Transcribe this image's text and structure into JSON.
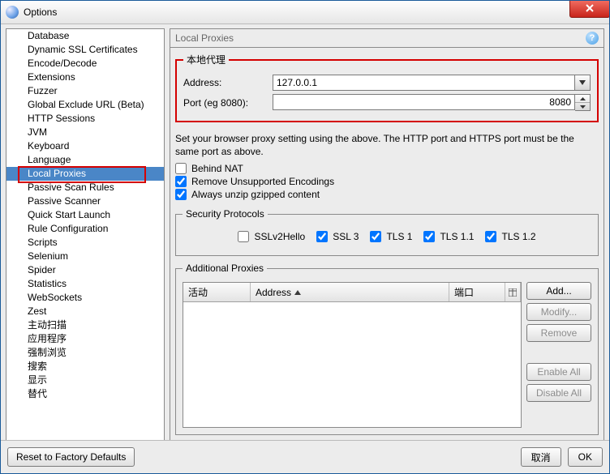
{
  "window_title": "Options",
  "sidebar": {
    "items": [
      "Database",
      "Dynamic SSL Certificates",
      "Encode/Decode",
      "Extensions",
      "Fuzzer",
      "Global Exclude URL (Beta)",
      "HTTP Sessions",
      "JVM",
      "Keyboard",
      "Language",
      "Local Proxies",
      "Passive Scan Rules",
      "Passive Scanner",
      "Quick Start Launch",
      "Rule Configuration",
      "Scripts",
      "Selenium",
      "Spider",
      "Statistics",
      "WebSockets",
      "Zest",
      "主动扫描",
      "应用程序",
      "强制浏览",
      "搜索",
      "显示",
      "替代"
    ],
    "selected_index": 10
  },
  "panel": {
    "title": "Local Proxies",
    "help_tooltip": "?",
    "local_proxy_legend": "本地代理",
    "address_label": "Address:",
    "address_value": "127.0.0.1",
    "port_label": "Port (eg 8080):",
    "port_value": "8080",
    "hint": "Set your browser proxy setting using the above.  The HTTP port and HTTPS port must be the same port as above.",
    "ck_behind_nat": "Behind NAT",
    "ck_remove_enc": "Remove Unsupported Encodings",
    "ck_unzip": "Always unzip gzipped content",
    "ck_behind_nat_checked": false,
    "ck_remove_enc_checked": true,
    "ck_unzip_checked": true,
    "security_legend": "Security Protocols",
    "proto_sslv2": "SSLv2Hello",
    "proto_ssl3": "SSL 3",
    "proto_tls1": "TLS 1",
    "proto_tls11": "TLS 1.1",
    "proto_tls12": "TLS 1.2",
    "addl_legend": "Additional Proxies",
    "col_enabled": "活动",
    "col_address": "Address",
    "col_port": "端口",
    "btn_add": "Add...",
    "btn_modify": "Modify...",
    "btn_remove": "Remove",
    "btn_enable_all": "Enable All",
    "btn_disable_all": "Disable All"
  },
  "footer": {
    "reset": "Reset to Factory Defaults",
    "cancel": "取消",
    "ok": "OK"
  }
}
